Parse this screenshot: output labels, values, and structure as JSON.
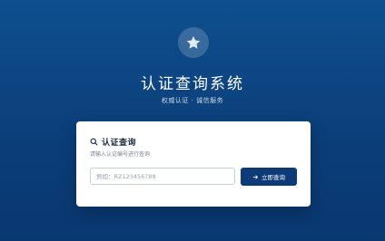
{
  "header": {
    "logo_icon": "star-icon",
    "title": "认证查询系统",
    "subtitle": "权威认证 · 诚信服务"
  },
  "card": {
    "title_icon": "search-icon",
    "title": "认证查询",
    "description": "请输入认证编号进行查询",
    "input": {
      "value": "",
      "placeholder": "例如：RZ123456789"
    },
    "button": {
      "icon": "arrow-right-icon",
      "label": "立即查询"
    }
  },
  "colors": {
    "background_top": "#0f4f8f",
    "background_bottom": "#0a3770",
    "button": "#0c3b78",
    "card": "#ffffff"
  }
}
